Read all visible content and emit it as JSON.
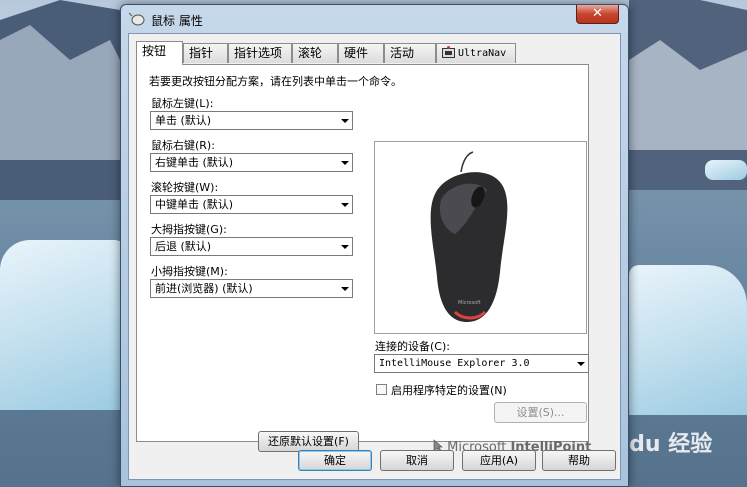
{
  "window": {
    "title": "鼠标 属性",
    "close_glyph": "✕"
  },
  "tabs": [
    {
      "label": "按钮",
      "active": true
    },
    {
      "label": "指针",
      "active": false
    },
    {
      "label": "指针选项",
      "active": false
    },
    {
      "label": "滚轮",
      "active": false
    },
    {
      "label": "硬件",
      "active": false
    },
    {
      "label": "活动",
      "active": false
    },
    {
      "label": "UltraNav",
      "active": false
    }
  ],
  "panel": {
    "instruction": "若要更改按钮分配方案，请在列表中单击一个命令。",
    "buttons": [
      {
        "label": "鼠标左键(L):",
        "value": "单击 (默认)"
      },
      {
        "label": "鼠标右键(R):",
        "value": "右键单击 (默认)"
      },
      {
        "label": "滚轮按键(W):",
        "value": "中键单击 (默认)"
      },
      {
        "label": "大拇指按键(G):",
        "value": "后退 (默认)"
      },
      {
        "label": "小拇指按键(M):",
        "value": "前进(浏览器) (默认)"
      }
    ],
    "device_label": "连接的设备(C):",
    "device_value": "IntelliMouse Explorer 3.0",
    "program_specific_label": "启用程序特定的设置(N)",
    "program_specific_checked": false,
    "settings_button": "设置(S)...",
    "restore_button": "还原默认设置(F)",
    "brand_text_light": "Microsoft",
    "brand_text_bold": "IntelliPoint",
    "mouse_logo_text": "Microsoft"
  },
  "footer": {
    "ok": "确定",
    "cancel": "取消",
    "apply": "应用(A)",
    "help": "帮助"
  },
  "watermark": "Baidu 经验"
}
